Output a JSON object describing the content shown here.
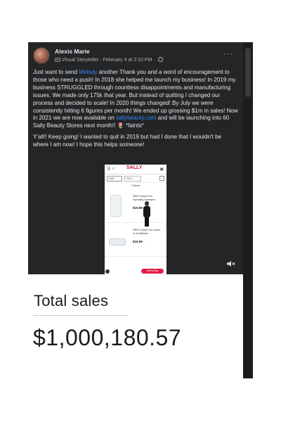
{
  "post": {
    "author": "Alexis Marie",
    "badge": "Visual Storyteller",
    "separator": "·",
    "date": "February 4 at 2:10 PM",
    "more_label": "···",
    "paragraph1_parts": {
      "a": "Just want to send ",
      "mention": "Melody",
      "b": " another Thank you and a word of encouragement to those who need a push! In 2018 she helped me launch my business! In 2019 my business STRUGGLED through countless disappointments and manufacturing issues. We made only 175k that year. But instead of quitting I changed our process and decided to scale! In 2020 things changed! By July we were consistently hitting 6 figures per month! We ended up grossing $1m in sales! Now in 2021 we are now available on ",
      "link": "sallybeauty.com",
      "c": " and will be launching into 60 Sally Beauty Stores next month!! ",
      "emoji": "🌷",
      "d": " *faints*"
    },
    "paragraph2": "Y'all!! Keep going! I wanted to quit in 2019 but had I done that I wouldn't be where I am now! I hope this helps someone!"
  },
  "phone": {
    "menu_icon": "menu-icon",
    "search_icon": "search-icon",
    "logo": "SALLY",
    "cart_icon": "cart-icon",
    "filter1": "Sort",
    "filter2": "Filter",
    "count": "7 Items",
    "product1": {
      "text": "NEW Crystal Curl Hydrating Shampoo",
      "price": "$15.99",
      "stars": "☆☆☆☆☆"
    },
    "product2": {
      "text": "NEW Crystal Curl Leave-in Conditioner",
      "price": "$16.99",
      "stars": "☆☆☆☆☆"
    },
    "cta": "Add to Bag"
  },
  "volume_icon": "volume-icon",
  "sales": {
    "label": "Total sales",
    "value": "$1,000,180.57"
  },
  "colors": {
    "post_bg": "#242526",
    "link": "#2d88ff",
    "text_light": "#e4e6eb",
    "sally_red": "#c8102e"
  }
}
